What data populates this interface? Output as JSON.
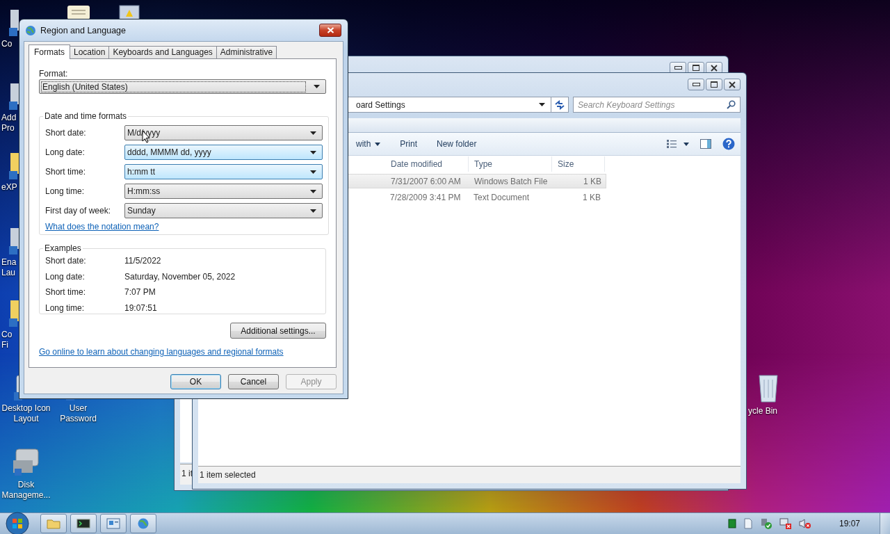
{
  "desktop": {
    "icons": [
      {
        "label": "Co"
      },
      {
        "label": "Add Pro"
      },
      {
        "label": "eXP"
      },
      {
        "label": "Ena Lau"
      },
      {
        "label": "Co Fi"
      },
      {
        "label": "Desktop Icon Layout"
      },
      {
        "label": "User Password"
      },
      {
        "label": "Disk Manageme..."
      },
      {
        "label": "ycle Bin"
      }
    ]
  },
  "explorer_back": {
    "status": "1 it"
  },
  "explorer_front": {
    "address": "oard Settings",
    "search": {
      "placeholder": "Search Keyboard Settings"
    },
    "toolbar": [
      {
        "label": "with",
        "kind": "dropdown"
      },
      {
        "label": "Print",
        "kind": "button"
      },
      {
        "label": "New folder",
        "kind": "button"
      }
    ],
    "columns": [
      "Date modified",
      "Type",
      "Size"
    ],
    "rows": [
      {
        "date": "7/31/2007 6:00 AM",
        "type": "Windows Batch File",
        "size": "1 KB",
        "selected": true
      },
      {
        "date": "7/28/2009 3:41 PM",
        "type": "Text Document",
        "size": "1 KB",
        "selected": false
      }
    ],
    "status": "1 item selected"
  },
  "dialog": {
    "title": "Region and Language",
    "tabs": [
      {
        "label": "Formats",
        "selected": true
      },
      {
        "label": "Location",
        "selected": false
      },
      {
        "label": "Keyboards and Languages",
        "selected": false
      },
      {
        "label": "Administrative",
        "selected": false
      }
    ],
    "format": {
      "label": "Format:",
      "value": "English (United States)"
    },
    "formats_group": {
      "title": "Date and time formats",
      "settings": [
        {
          "label": "Short date:",
          "value": "M/d/yyyy"
        },
        {
          "label": "Long date:",
          "value": "dddd, MMMM dd, yyyy"
        },
        {
          "label": "Short time:",
          "value": "h:mm tt"
        },
        {
          "label": "Long time:",
          "value": "H:mm:ss"
        },
        {
          "label": "First day of week:",
          "value": "Sunday"
        }
      ],
      "link": "What does the notation mean?"
    },
    "examples_group": {
      "title": "Examples",
      "rows": [
        {
          "label": "Short date:",
          "value": "11/5/2022"
        },
        {
          "label": "Long date:",
          "value": "Saturday, November 05, 2022"
        },
        {
          "label": "Short time:",
          "value": "7:07 PM"
        },
        {
          "label": "Long time:",
          "value": "19:07:51"
        }
      ]
    },
    "additional_button": "Additional settings...",
    "online_link": "Go online to learn about changing languages and regional formats",
    "buttons": [
      {
        "label": "OK",
        "default": true,
        "disabled": false
      },
      {
        "label": "Cancel",
        "default": false,
        "disabled": false
      },
      {
        "label": "Apply",
        "default": false,
        "disabled": true
      }
    ]
  },
  "taskbar": {
    "clock": "19:07"
  }
}
